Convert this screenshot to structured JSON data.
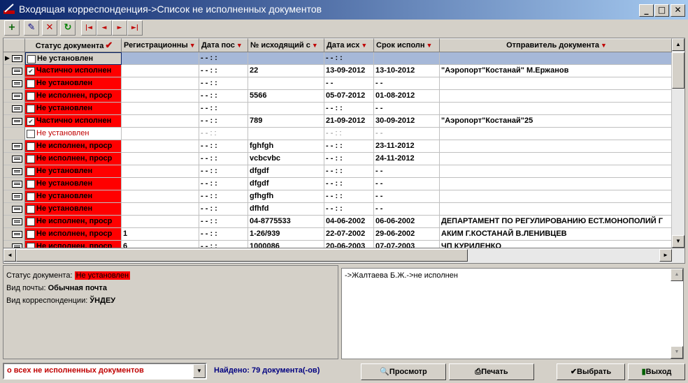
{
  "window": {
    "title": "Входящая корреспонденция->Список не исполненных документов",
    "minimize": "_",
    "maximize": "□",
    "close": "✕"
  },
  "toolbar": {
    "add": "+",
    "edit": "✎",
    "delete": "✕",
    "refresh": "↻",
    "first": "|◄",
    "prev": "◄",
    "next": "►",
    "last": "►|"
  },
  "grid": {
    "columns": [
      "Статус документа",
      "Регистрационны",
      "Дата пос",
      "№ исходящий с",
      "Дата исх",
      "Срок исполн",
      "Отправитель документа"
    ],
    "rows": [
      {
        "status": "Не установлен",
        "checked": false,
        "reg": "",
        "date_in": "  -  -     : :",
        "out_no": "",
        "date_out": "  -  -      : :",
        "deadline": "",
        "sender": "",
        "selected": true
      },
      {
        "status": "Частично исполнен",
        "checked": true,
        "reg": "",
        "date_in": "  -  -      : :",
        "out_no": "22",
        "date_out": "13-09-2012",
        "deadline": "13-10-2012",
        "sender": "\"Аэропорт\"Костанай\" М.Ержанов"
      },
      {
        "status": "Не установлен",
        "checked": false,
        "reg": "",
        "date_in": "  -  -      : :",
        "out_no": "",
        "date_out": "  -  -",
        "deadline": "  -  -",
        "sender": ""
      },
      {
        "status": "Не исполнен, проср",
        "checked": false,
        "reg": "",
        "date_in": "  -  -      : :",
        "out_no": "5566",
        "date_out": "05-07-2012",
        "deadline": "01-08-2012",
        "sender": ""
      },
      {
        "status": "Не установлен",
        "checked": false,
        "reg": "",
        "date_in": "  -  -      : :",
        "out_no": "",
        "date_out": "  -  -      : :",
        "deadline": "  -  -",
        "sender": ""
      },
      {
        "status": "Частично исполнен",
        "checked": true,
        "reg": "",
        "date_in": "  -  -      : :",
        "out_no": "789",
        "date_out": "21-09-2012",
        "deadline": "30-09-2012",
        "sender": "\"Аэропорт\"Костанай\"25"
      },
      {
        "status": "Не установлен",
        "checked": false,
        "reg": "",
        "date_in": "  -  -      : :",
        "out_no": "",
        "date_out": "  -  -      : :",
        "deadline": "  -  -",
        "sender": "",
        "faded": true
      },
      {
        "status": "Не исполнен, проср",
        "checked": false,
        "reg": "",
        "date_in": "  -  -      : :",
        "out_no": "fghfgh",
        "date_out": "  -  -      : :",
        "deadline": "23-11-2012",
        "sender": ""
      },
      {
        "status": "Не исполнен, проср",
        "checked": false,
        "reg": "",
        "date_in": "  -  -      : :",
        "out_no": "vcbcvbc",
        "date_out": "  -  -      : :",
        "deadline": "24-11-2012",
        "sender": ""
      },
      {
        "status": "Не установлен",
        "checked": false,
        "reg": "",
        "date_in": "  -  -      : :",
        "out_no": "dfgdf",
        "date_out": "  -  -      : :",
        "deadline": "  -  -",
        "sender": ""
      },
      {
        "status": "Не установлен",
        "checked": false,
        "reg": "",
        "date_in": "  -  -      : :",
        "out_no": "dfgdf",
        "date_out": "  -  -      : :",
        "deadline": "  -  -",
        "sender": ""
      },
      {
        "status": "Не установлен",
        "checked": false,
        "reg": "",
        "date_in": "  -  -      : :",
        "out_no": "gfhgfh",
        "date_out": "  -  -      : :",
        "deadline": "  -  -",
        "sender": ""
      },
      {
        "status": "Не установлен",
        "checked": false,
        "reg": "",
        "date_in": "  -  -      : :",
        "out_no": "dfhfd",
        "date_out": "  -  -      : :",
        "deadline": "  -  -",
        "sender": ""
      },
      {
        "status": "Не исполнен, проср",
        "checked": false,
        "reg": "",
        "date_in": "  -  -      : :",
        "out_no": "04-8775533",
        "date_out": "04-06-2002",
        "deadline": "06-06-2002",
        "sender": "ДЕПАРТАМЕНТ ПО РЕГУЛИРОВАНИЮ ЕСТ.МОНОПОЛИЙ Г"
      },
      {
        "status": "Не исполнен, проср",
        "checked": false,
        "reg": "1",
        "date_in": "  -  -      : :",
        "out_no": "1-26/939",
        "date_out": "22-07-2002",
        "deadline": "29-06-2002",
        "sender": "АКИМ Г.КОСТАНАЙ В.ЛЕНИВЦЕВ"
      },
      {
        "status": "Не исполнен, проср",
        "checked": false,
        "reg": "6",
        "date_in": "  -  -      : :",
        "out_no": "1000086",
        "date_out": "20-06-2003",
        "deadline": "07-07-2003",
        "sender": "ЧП КУРИЛЕНКО"
      }
    ]
  },
  "details": {
    "status_label": "Статус документа:",
    "status_value": "Не установлен",
    "mail_label": "Вид почты:",
    "mail_value": "Обычная почта",
    "corr_label": "Вид корреспонденции:",
    "corr_value": "ЎНДЕУ",
    "route": "->Жалтаева Б.Ж.->не исполнен"
  },
  "statusbar": {
    "filter": "о всех не исполненных документов",
    "found": "Найдено: 79 документа(-ов)",
    "preview": "Просмотр",
    "print": "Печать",
    "select": "Выбрать",
    "exit": "Выход"
  },
  "colors": {
    "status_red": "#ff0000",
    "title_start": "#0a246a",
    "title_end": "#a6caf0",
    "found_text": "#000080"
  }
}
